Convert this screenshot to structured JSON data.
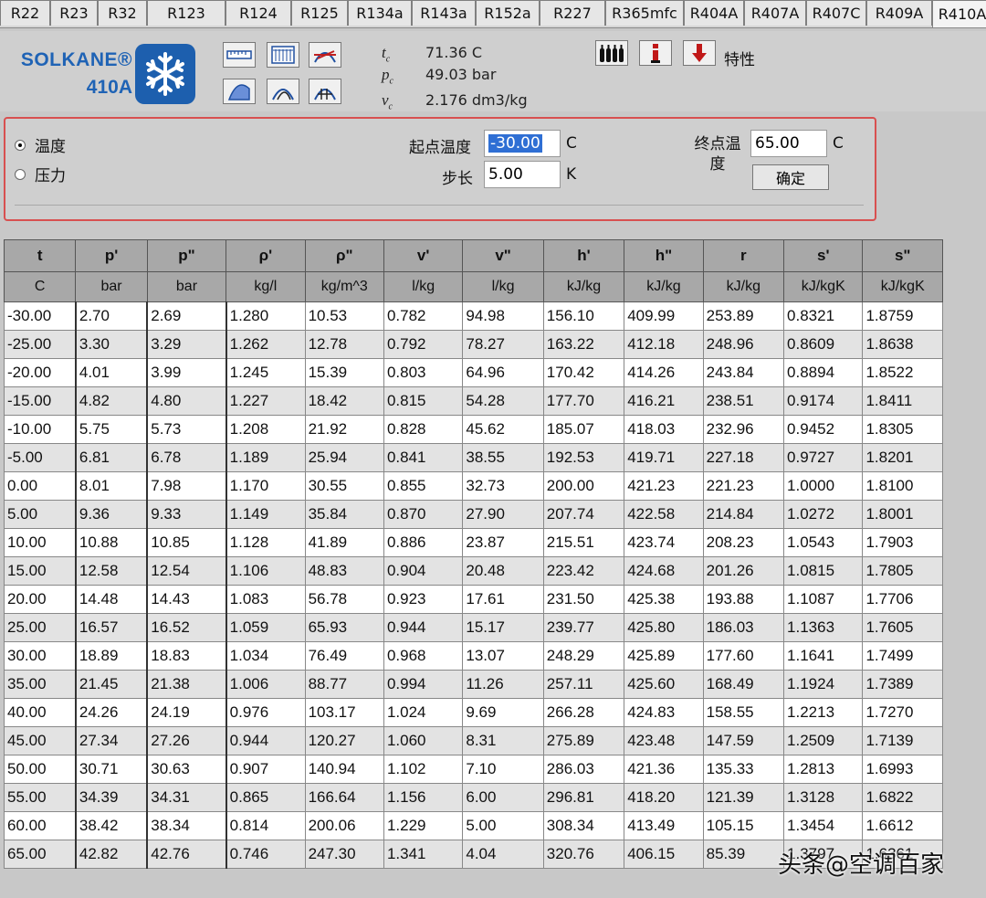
{
  "tabs": [
    "R22",
    "R23",
    "R32",
    "R123",
    "R124",
    "R125",
    "R134a",
    "R143a",
    "R152a",
    "R227",
    "R365mfc",
    "R404A",
    "R407A",
    "R407C",
    "R409A",
    "R410A"
  ],
  "active_tab": "R410A",
  "brand": {
    "name": "SOLKANE®",
    "model": "410A"
  },
  "critical": {
    "tc": {
      "label": "t",
      "sub": "c",
      "value": "71.36   C"
    },
    "pc": {
      "label": "p",
      "sub": "c",
      "value": "49.03  bar"
    },
    "vc": {
      "label": "v",
      "sub": "c",
      "value": "2.176  dm3/kg"
    }
  },
  "properties_label": "特性",
  "controls": {
    "radio_temp": "温度",
    "radio_pressure": "压力",
    "start_label": "起点温度",
    "start_value": "-30.00",
    "start_unit": "C",
    "step_label": "步长",
    "step_value": "5.00",
    "step_unit": "K",
    "end_label": "终点温度",
    "end_value": "65.00",
    "end_unit": "C",
    "ok_button": "确定"
  },
  "table": {
    "headers": [
      "t",
      "p'",
      "p\"",
      "ρ'",
      "ρ\"",
      "v'",
      "v\"",
      "h'",
      "h\"",
      "r",
      "s'",
      "s\""
    ],
    "units": [
      "C",
      "bar",
      "bar",
      "kg/l",
      "kg/m^3",
      "l/kg",
      "l/kg",
      "kJ/kg",
      "kJ/kg",
      "kJ/kg",
      "kJ/kgK",
      "kJ/kgK"
    ],
    "rows": [
      [
        "-30.00",
        "2.70",
        "2.69",
        "1.280",
        "10.53",
        "0.782",
        "94.98",
        "156.10",
        "409.99",
        "253.89",
        "0.8321",
        "1.8759"
      ],
      [
        "-25.00",
        "3.30",
        "3.29",
        "1.262",
        "12.78",
        "0.792",
        "78.27",
        "163.22",
        "412.18",
        "248.96",
        "0.8609",
        "1.8638"
      ],
      [
        "-20.00",
        "4.01",
        "3.99",
        "1.245",
        "15.39",
        "0.803",
        "64.96",
        "170.42",
        "414.26",
        "243.84",
        "0.8894",
        "1.8522"
      ],
      [
        "-15.00",
        "4.82",
        "4.80",
        "1.227",
        "18.42",
        "0.815",
        "54.28",
        "177.70",
        "416.21",
        "238.51",
        "0.9174",
        "1.8411"
      ],
      [
        "-10.00",
        "5.75",
        "5.73",
        "1.208",
        "21.92",
        "0.828",
        "45.62",
        "185.07",
        "418.03",
        "232.96",
        "0.9452",
        "1.8305"
      ],
      [
        "-5.00",
        "6.81",
        "6.78",
        "1.189",
        "25.94",
        "0.841",
        "38.55",
        "192.53",
        "419.71",
        "227.18",
        "0.9727",
        "1.8201"
      ],
      [
        "0.00",
        "8.01",
        "7.98",
        "1.170",
        "30.55",
        "0.855",
        "32.73",
        "200.00",
        "421.23",
        "221.23",
        "1.0000",
        "1.8100"
      ],
      [
        "5.00",
        "9.36",
        "9.33",
        "1.149",
        "35.84",
        "0.870",
        "27.90",
        "207.74",
        "422.58",
        "214.84",
        "1.0272",
        "1.8001"
      ],
      [
        "10.00",
        "10.88",
        "10.85",
        "1.128",
        "41.89",
        "0.886",
        "23.87",
        "215.51",
        "423.74",
        "208.23",
        "1.0543",
        "1.7903"
      ],
      [
        "15.00",
        "12.58",
        "12.54",
        "1.106",
        "48.83",
        "0.904",
        "20.48",
        "223.42",
        "424.68",
        "201.26",
        "1.0815",
        "1.7805"
      ],
      [
        "20.00",
        "14.48",
        "14.43",
        "1.083",
        "56.78",
        "0.923",
        "17.61",
        "231.50",
        "425.38",
        "193.88",
        "1.1087",
        "1.7706"
      ],
      [
        "25.00",
        "16.57",
        "16.52",
        "1.059",
        "65.93",
        "0.944",
        "15.17",
        "239.77",
        "425.80",
        "186.03",
        "1.1363",
        "1.7605"
      ],
      [
        "30.00",
        "18.89",
        "18.83",
        "1.034",
        "76.49",
        "0.968",
        "13.07",
        "248.29",
        "425.89",
        "177.60",
        "1.1641",
        "1.7499"
      ],
      [
        "35.00",
        "21.45",
        "21.38",
        "1.006",
        "88.77",
        "0.994",
        "11.26",
        "257.11",
        "425.60",
        "168.49",
        "1.1924",
        "1.7389"
      ],
      [
        "40.00",
        "24.26",
        "24.19",
        "0.976",
        "103.17",
        "1.024",
        "9.69",
        "266.28",
        "424.83",
        "158.55",
        "1.2213",
        "1.7270"
      ],
      [
        "45.00",
        "27.34",
        "27.26",
        "0.944",
        "120.27",
        "1.060",
        "8.31",
        "275.89",
        "423.48",
        "147.59",
        "1.2509",
        "1.7139"
      ],
      [
        "50.00",
        "30.71",
        "30.63",
        "0.907",
        "140.94",
        "1.102",
        "7.10",
        "286.03",
        "421.36",
        "135.33",
        "1.2813",
        "1.6993"
      ],
      [
        "55.00",
        "34.39",
        "34.31",
        "0.865",
        "166.64",
        "1.156",
        "6.00",
        "296.81",
        "418.20",
        "121.39",
        "1.3128",
        "1.6822"
      ],
      [
        "60.00",
        "38.42",
        "38.34",
        "0.814",
        "200.06",
        "1.229",
        "5.00",
        "308.34",
        "413.49",
        "105.15",
        "1.3454",
        "1.6612"
      ],
      [
        "65.00",
        "42.82",
        "42.76",
        "0.746",
        "247.30",
        "1.341",
        "4.04",
        "320.76",
        "406.15",
        "85.39",
        "1.3797",
        "1.6361"
      ]
    ]
  },
  "watermark": "头条@空调百家"
}
